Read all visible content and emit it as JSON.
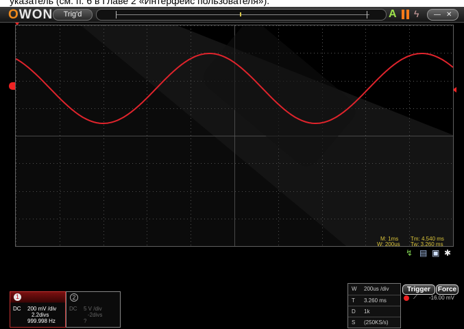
{
  "caption": {
    "text": "указатель (см. п. 6 в Главе 2 «Интерфейс пользователя»)."
  },
  "app": {
    "logo_brand": "OWON",
    "trigger_status": "Trig'd"
  },
  "title_icons": [
    "auto-icon",
    "pause-icon",
    "single-icon",
    "minimize-icon",
    "close-icon"
  ],
  "screen_info": {
    "main_timebase": "M: 1ms",
    "window_timebase": "W: 200us",
    "tm": "Tm: 4.540 ms",
    "tw": "Tw: 3.260 ms"
  },
  "waveform": {
    "color": "#e0242c",
    "shape": "sine",
    "frequency_hz": "999.998 Hz"
  },
  "channel1": {
    "number": "1",
    "coupling": "DC",
    "scale": "200 mV /div",
    "offset": "2.2divs",
    "frequency": "999.998 Hz"
  },
  "channel2": {
    "number": "2",
    "coupling": "DC",
    "scale": "5 V /div",
    "offset": "-2divs",
    "extra": "?"
  },
  "timebase_table": {
    "rows": [
      {
        "key": "W",
        "value": "200us /div"
      },
      {
        "key": "T",
        "value": "3.260 ms"
      },
      {
        "key": "D",
        "value": "1k"
      },
      {
        "key": "S",
        "value": "(250KS/s)"
      }
    ]
  },
  "trigger": {
    "trigger_label": "Trigger",
    "force_label": "Force",
    "level": "-16.00 mV"
  },
  "colors": {
    "accent": "#e0242c",
    "info": "#d8c23a",
    "logo_orange": "#f08a1c",
    "grid": "#666666"
  }
}
